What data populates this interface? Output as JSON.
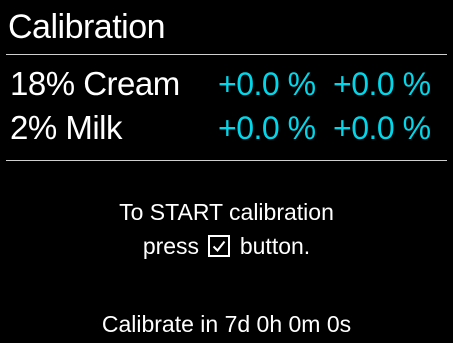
{
  "header": {
    "title": "Calibration"
  },
  "calibration_rows": [
    {
      "label": "18% Cream",
      "value_1": "+0.0 %",
      "value_2": "+0.0 %"
    },
    {
      "label": "2% Milk",
      "value_1": "+0.0 %",
      "value_2": "+0.0 %"
    }
  ],
  "instructions": {
    "line_1": "To START calibration",
    "line_2_prefix": "press",
    "line_2_suffix": "button."
  },
  "footer": {
    "countdown": "Calibrate in 7d 0h 0m 0s"
  },
  "icons": {
    "confirm_icon": "check-box-icon"
  },
  "colors": {
    "background": "#000000",
    "text": "#ffffff",
    "value_accent": "#00d7ea",
    "divider": "#cfcfcf"
  }
}
